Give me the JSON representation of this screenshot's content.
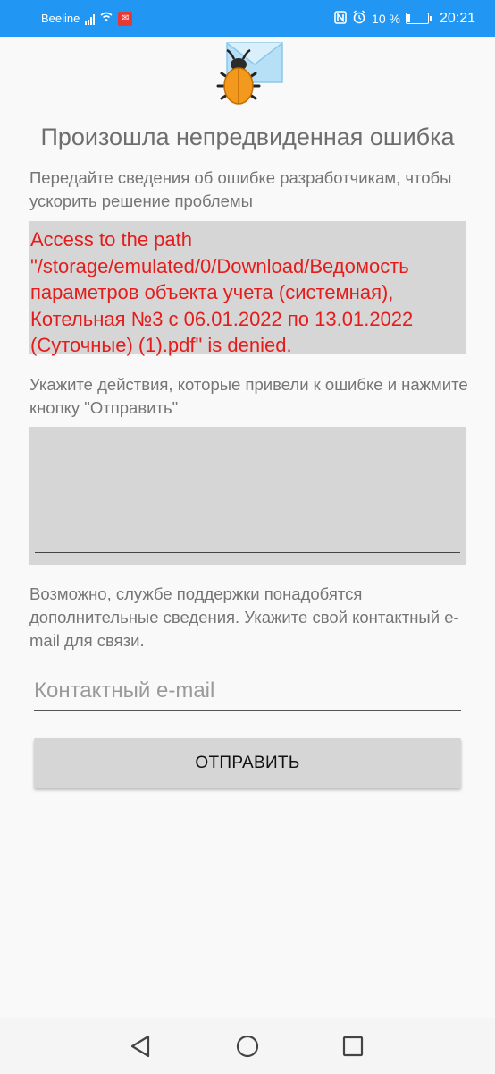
{
  "status_bar": {
    "carrier": "Beeline",
    "battery_percent": "10 %",
    "time": "20:21",
    "icons": [
      "signal-icon",
      "wifi-icon",
      "app-notification-icon",
      "nfc-icon",
      "alarm-icon",
      "battery-icon"
    ]
  },
  "screen": {
    "title": "Произошла непредвиденная ошибка",
    "intro_text": "Передайте сведения об ошибке разработчикам, чтобы ускорить решение проблемы",
    "error_message": "Access to the path \"/storage/emulated/0/Download/Ведомость параметров объекта учета (системная), Котельная №3 с 06.01.2022 по 13.01.2022 (Суточные) (1).pdf\" is denied.",
    "actions_prompt": "Укажите действия, которые привели к ошибке и нажмите кнопку \"Отправить\"",
    "actions_value": "",
    "contact_prompt": "Возможно, службе поддержки понадобятся дополнительные сведения. Укажите свой контактный e-mail для связи.",
    "email_placeholder": "Контактный e-mail",
    "email_value": "",
    "send_label": "ОТПРАВИТЬ"
  },
  "colors": {
    "status_bar": "#2196f3",
    "error_text": "#e51c1c",
    "field_background": "#d6d6d6"
  },
  "nav_bar": {
    "icons": [
      "back-icon",
      "home-icon",
      "recents-icon"
    ]
  }
}
